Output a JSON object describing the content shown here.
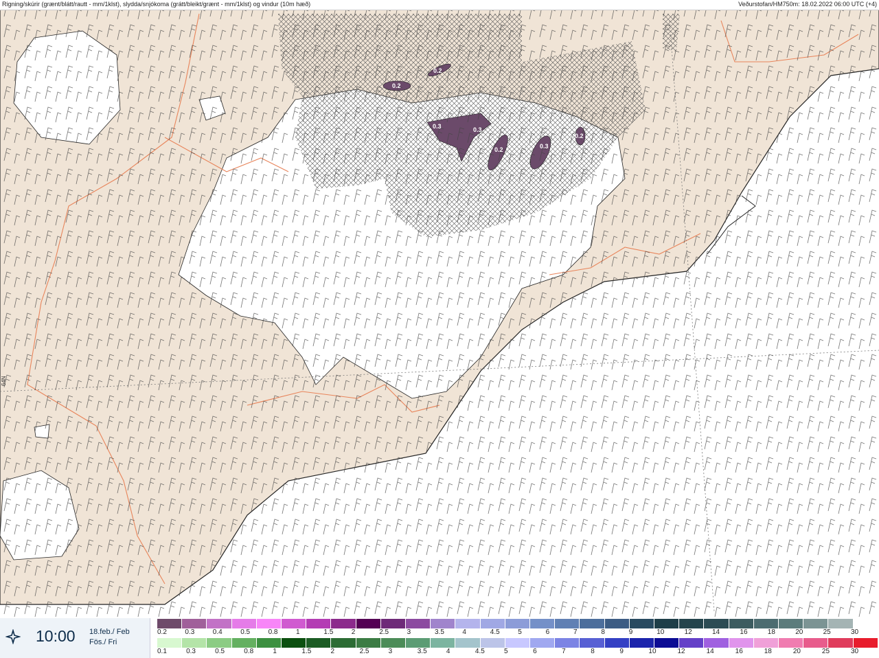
{
  "header": {
    "left_title": "Rigning/skúrir (grænt/blátt/rautt - mm/1klst), slydda/snjókoma (grátt/bleikt/grænt - mm/1klst) og vindur (10m hæð)",
    "right_title": "Veðurstofan/HM750m: 18.02.2022 06:00 UTC (+4)"
  },
  "map": {
    "latitude_label": "64N",
    "precip_labels": [
      "0.2",
      "0.2",
      "0.3",
      "0.3",
      "0.2",
      "0.3",
      "0.2"
    ],
    "colors": {
      "land": "#f0e4d6",
      "snow": "#ffffff",
      "coast": "#222222",
      "roads": "#e8845a",
      "precip": "#6b4a6a"
    }
  },
  "time": {
    "icon": "compass-icon",
    "value": "10:00",
    "date_line1": "18.feb./ Feb",
    "date_line2": "Fös./ Fri"
  },
  "legend": {
    "snow_scale": {
      "colors": [
        "#6e4a6a",
        "#a0609a",
        "#c272c6",
        "#e57ce8",
        "#f886f8",
        "#d05ad0",
        "#b43cb4",
        "#8c2a8c",
        "#540054",
        "#6e2a78",
        "#8c4aa0",
        "#a084cc",
        "#b4b4ec",
        "#a0a8e4",
        "#8c9cd8",
        "#7490c8",
        "#6080b4",
        "#4c6e9c",
        "#3c5c84",
        "#284a60",
        "#1e3e48",
        "#24444c",
        "#2c4c54",
        "#3c5c60",
        "#4c6c70",
        "#5c7c7c",
        "#7c9494",
        "#a4b4b4",
        "#ffffff"
      ],
      "labels": [
        "0.2",
        "0.3",
        "0.4",
        "0.5",
        "0.8",
        "1",
        "1.5",
        "2",
        "2.5",
        "3",
        "3.5",
        "4",
        "4.5",
        "5",
        "6",
        "7",
        "8",
        "9",
        "10",
        "12",
        "14",
        "16",
        "18",
        "20",
        "25",
        "30"
      ]
    },
    "rain_scale": {
      "colors": [
        "#d8f8d0",
        "#b4e4a8",
        "#8ccc84",
        "#64b060",
        "#3c9040",
        "#0c5010",
        "#1c5c24",
        "#2c6c34",
        "#3c7c44",
        "#4c8c58",
        "#5c9c74",
        "#7cb4a0",
        "#a4c4cc",
        "#bcc4e8",
        "#c8c8ff",
        "#a0a8f0",
        "#7c84e4",
        "#5860d4",
        "#3440c4",
        "#1c24ac",
        "#0c0c94",
        "#6440c8",
        "#a060e0",
        "#e094ec",
        "#f0a0d8",
        "#f07cb0",
        "#e85c8c",
        "#e03c5c",
        "#e81c2c"
      ],
      "labels": [
        "0.1",
        "0.3",
        "0.5",
        "0.8",
        "1",
        "1.5",
        "2",
        "2.5",
        "3",
        "3.5",
        "4",
        "4.5",
        "5",
        "6",
        "7",
        "8",
        "9",
        "10",
        "12",
        "14",
        "16",
        "18",
        "20",
        "25",
        "30"
      ]
    }
  }
}
